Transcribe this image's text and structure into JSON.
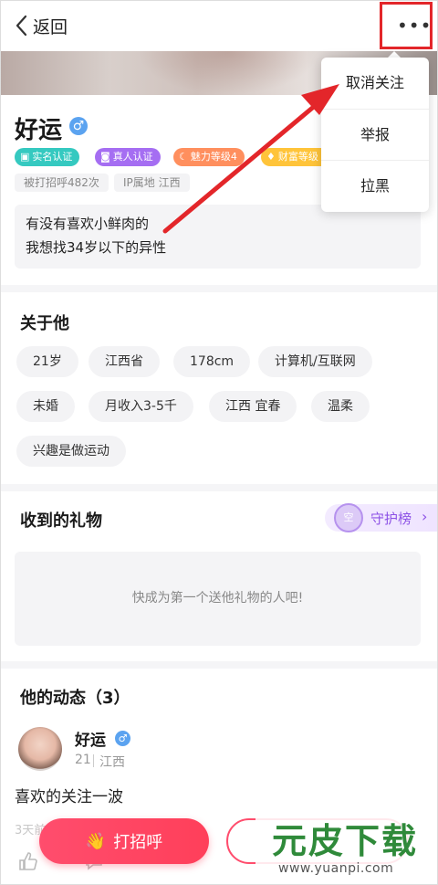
{
  "header": {
    "back_label": "返回",
    "more_icon": "more-horizontal-icon"
  },
  "menu": {
    "items": [
      "取消关注",
      "举报",
      "拉黑"
    ]
  },
  "profile": {
    "name": "好运",
    "gender_symbol": "♂",
    "badges": [
      {
        "label": "实名认证",
        "icon": "id-card-icon",
        "color": "#35c9c0"
      },
      {
        "label": "真人认证",
        "icon": "camera-icon",
        "color": "#a56ef2"
      },
      {
        "label": "魅力等级4",
        "icon": "moon-icon",
        "color": "#ff8f5e"
      },
      {
        "label": "财富等级",
        "icon": "diamond-icon",
        "color": "#ffc43a"
      }
    ],
    "meta": [
      "被打招呼482次",
      "IP属地 江西"
    ],
    "bio_lines": [
      "有没有喜欢小鲜肉的",
      "我想找34岁以下的异性"
    ]
  },
  "about": {
    "title": "关于他",
    "tags": [
      "21岁",
      "江西省",
      "178cm",
      "计算机/互联网",
      "未婚",
      "月收入3-5千",
      "江西 宜春",
      "温柔",
      "兴趣是做运动"
    ]
  },
  "gifts": {
    "title": "收到的礼物",
    "guard_label": "守护榜",
    "guard_avatar_text": "空",
    "empty_text": "快成为第一个送他礼物的人吧!"
  },
  "feed": {
    "title": "他的动态（3）",
    "post": {
      "name": "好运",
      "gender_symbol": "♂",
      "age": "21",
      "location": "江西",
      "text": "喜欢的关注一波",
      "time": "3天前"
    }
  },
  "actions": {
    "greet_label": "打招呼",
    "greet_icon": "👋"
  },
  "watermark": {
    "logo": "元皮下载",
    "url": "www.yuanpi.com"
  },
  "colors": {
    "accent": "#ff4d6d",
    "highlight_box": "#e3262a",
    "arrow": "#e3262a",
    "guard": "#8d52e6"
  }
}
